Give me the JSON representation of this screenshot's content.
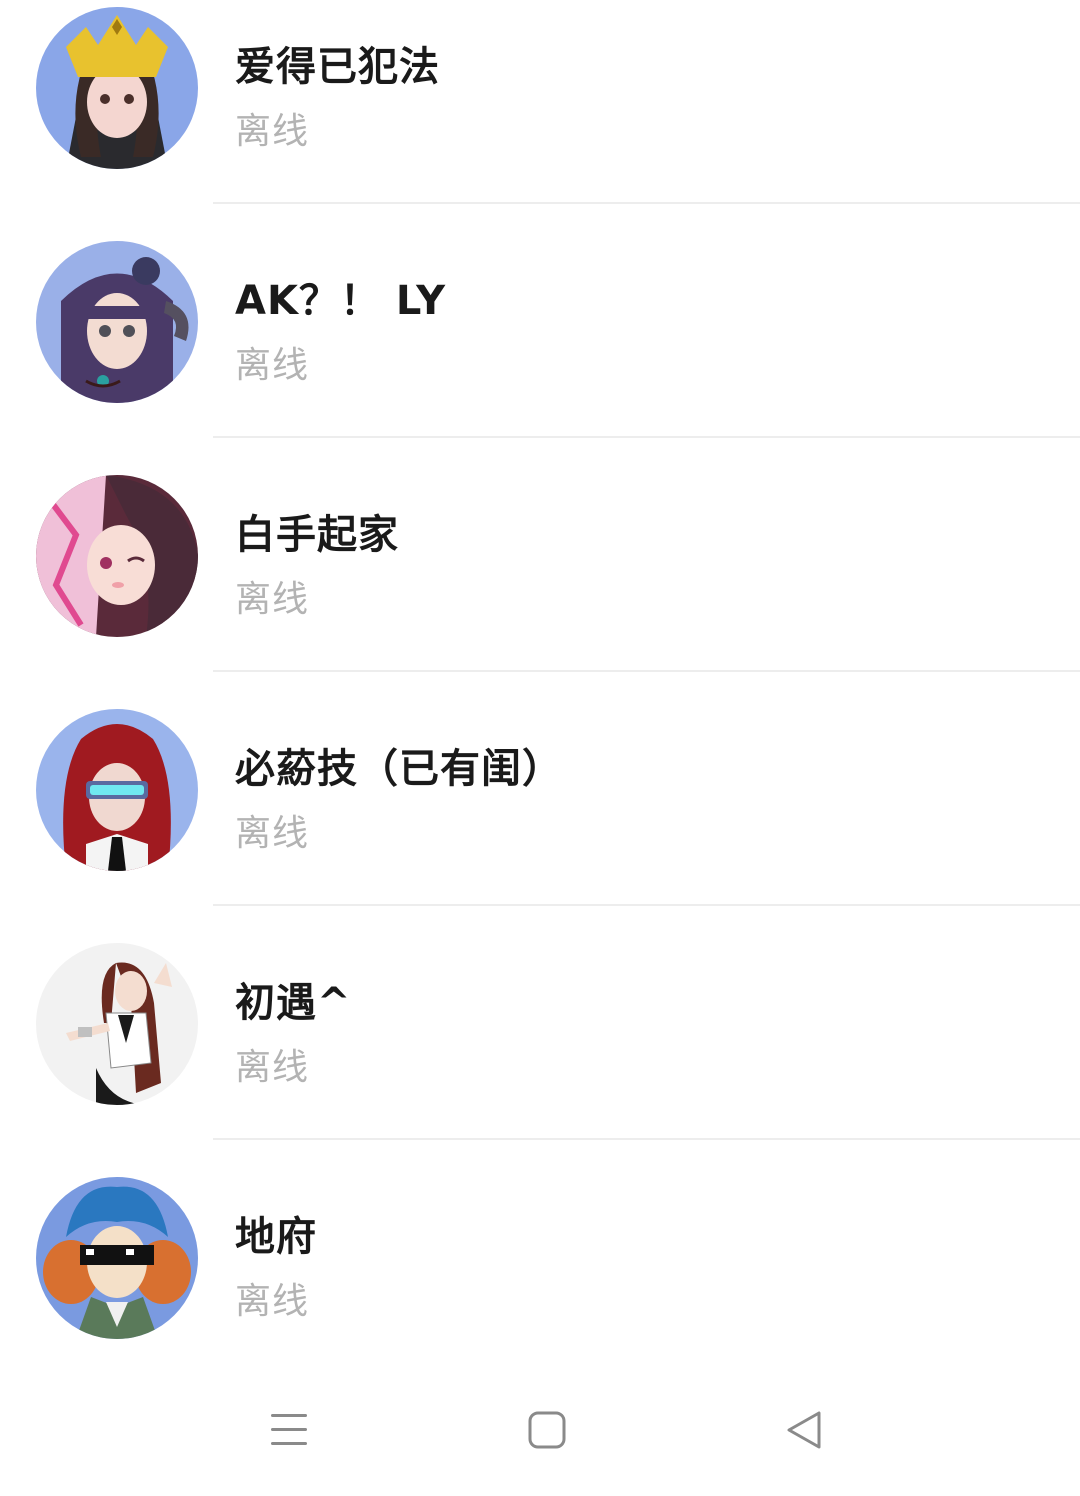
{
  "contacts": [
    {
      "name": "爱得已犯法",
      "status": "离线",
      "avatar": "anime-girl-gold-crown-avatar"
    },
    {
      "name": "AK？！ LY",
      "status": "离线",
      "avatar": "anime-girl-purple-hair-horns-avatar"
    },
    {
      "name": "白手起家",
      "status": "离线",
      "avatar": "anime-girl-pink-white-hair-avatar"
    },
    {
      "name": "必蒶技（已有闺）",
      "status": "离线",
      "avatar": "anime-girl-red-hair-visor-avatar"
    },
    {
      "name": "初遇^",
      "status": "离线",
      "avatar": "anime-girl-sailor-uniform-avatar"
    },
    {
      "name": "地府",
      "status": "离线",
      "avatar": "anime-boy-blue-hair-pixel-glasses-avatar"
    }
  ],
  "nav": {
    "menu_icon": "menu-icon",
    "home_icon": "home-square-icon",
    "back_icon": "back-triangle-icon"
  },
  "colors": {
    "name_text": "#1a1a1a",
    "status_text": "#b3b3b3",
    "divider": "#ededed",
    "nav_icon": "#8a8a8a"
  }
}
